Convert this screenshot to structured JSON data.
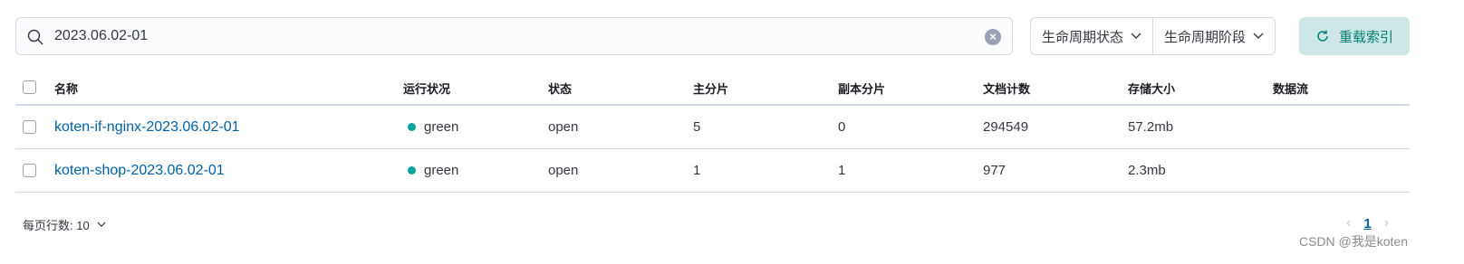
{
  "search": {
    "value": "2023.06.02-01"
  },
  "filters": [
    {
      "label": "生命周期状态"
    },
    {
      "label": "生命周期阶段"
    }
  ],
  "reload_button": {
    "label": "重载索引"
  },
  "table": {
    "columns": [
      "名称",
      "运行状况",
      "状态",
      "主分片",
      "副本分片",
      "文档计数",
      "存储大小",
      "数据流"
    ],
    "rows": [
      {
        "name": "koten-if-nginx-2023.06.02-01",
        "health": "green",
        "status": "open",
        "primary": "5",
        "replicas": "0",
        "docs": "294549",
        "size": "57.2mb",
        "datastream": ""
      },
      {
        "name": "koten-shop-2023.06.02-01",
        "health": "green",
        "status": "open",
        "primary": "1",
        "replicas": "1",
        "docs": "977",
        "size": "2.3mb",
        "datastream": ""
      }
    ]
  },
  "footer": {
    "rows_per_page": "每页行数: 10",
    "current_page": "1"
  },
  "colors": {
    "link": "#0061a6",
    "health_green": "#00a69b",
    "accent_bg": "#cce7e6",
    "accent_text": "#017d73"
  },
  "watermark": "CSDN @我是koten"
}
